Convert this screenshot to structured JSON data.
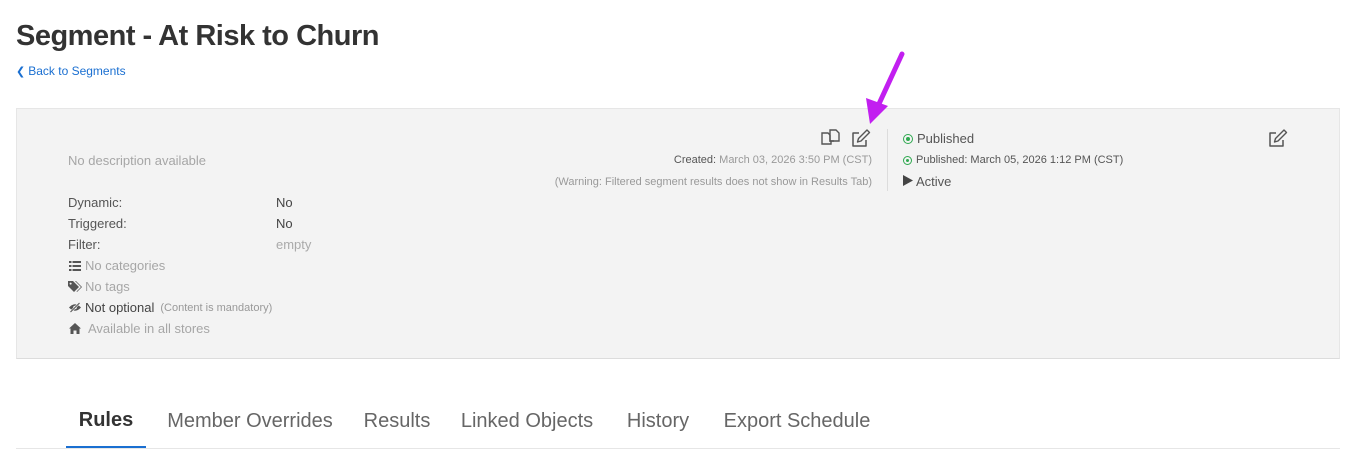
{
  "header": {
    "title": "Segment - At Risk to Churn",
    "back_label": "Back to Segments"
  },
  "details": {
    "description": "No description available",
    "properties": [
      {
        "label": "Dynamic:",
        "value": "No"
      },
      {
        "label": "Triggered:",
        "value": "No"
      },
      {
        "label": "Filter:",
        "value": "empty"
      }
    ],
    "categories_text": "No categories",
    "tags_text": "No tags",
    "optional_text": "Not optional",
    "optional_note": "(Content is mandatory)",
    "stores_text": "Available in all stores",
    "created_label": "Created:",
    "created_value": "March 03, 2026 3:50 PM (CST)",
    "warning": "(Warning: Filtered segment results does not show in Results Tab)"
  },
  "status": {
    "state": "Published",
    "published_date": "Published: March 05, 2026 1:12 PM (CST)",
    "activity": "Active",
    "status_color": "#2ea84f"
  },
  "icons": {
    "copy": "copy-icon",
    "edit": "edit-icon",
    "status_edit": "edit-icon",
    "categories": "list-icon",
    "tags": "tags-icon",
    "optional": "eye-slash-icon",
    "stores": "home-icon",
    "annotation": "arrow-annotation"
  },
  "tabs": [
    {
      "label": "Rules",
      "active": true
    },
    {
      "label": "Member Overrides",
      "active": false
    },
    {
      "label": "Results",
      "active": false
    },
    {
      "label": "Linked Objects",
      "active": false
    },
    {
      "label": "History",
      "active": false
    },
    {
      "label": "Export Schedule",
      "active": false
    }
  ],
  "colors": {
    "link": "#1a6fd1",
    "annotation_arrow": "#c21ff0",
    "panel_bg": "#f3f3f3"
  }
}
